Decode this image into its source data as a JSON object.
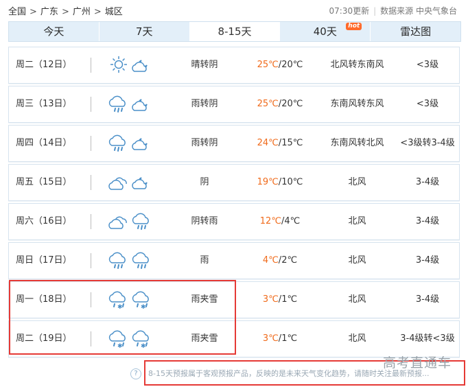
{
  "breadcrumb": {
    "items": [
      "全国",
      "广东",
      "广州",
      "城区"
    ],
    "sep": ">"
  },
  "update": {
    "time_text": "07:30更新",
    "source_text": "数据来源 中央气象台"
  },
  "tabs": [
    {
      "label": "今天"
    },
    {
      "label": "7天"
    },
    {
      "label": "8-15天"
    },
    {
      "label": "40天",
      "badge": "hot"
    },
    {
      "label": "雷达图"
    }
  ],
  "active_tab": "8-15天",
  "rows": [
    {
      "day": "周二（12日）",
      "icons": [
        "sun-icon",
        "cloudy-night-icon"
      ],
      "cond": "晴转阴",
      "hi": "25℃",
      "lo": "20℃",
      "wind": "北风转东南风",
      "level": "<3级"
    },
    {
      "day": "周三（13日）",
      "icons": [
        "rain-icon",
        "cloudy-night-icon"
      ],
      "cond": "雨转阴",
      "hi": "25℃",
      "lo": "20℃",
      "wind": "东南风转东风",
      "level": "<3级"
    },
    {
      "day": "周四（14日）",
      "icons": [
        "rain-icon",
        "cloudy-night-icon"
      ],
      "cond": "雨转阴",
      "hi": "24℃",
      "lo": "15℃",
      "wind": "东南风转北风",
      "level": "<3级转3-4级"
    },
    {
      "day": "周五（15日）",
      "icons": [
        "overcast-icon",
        "cloudy-night-icon"
      ],
      "cond": "阴",
      "hi": "19℃",
      "lo": "10℃",
      "wind": "北风",
      "level": "3-4级"
    },
    {
      "day": "周六（16日）",
      "icons": [
        "overcast-icon",
        "rain-icon"
      ],
      "cond": "阴转雨",
      "hi": "12℃",
      "lo": "4℃",
      "wind": "北风",
      "level": "3-4级"
    },
    {
      "day": "周日（17日）",
      "icons": [
        "rain-icon",
        "rain-icon"
      ],
      "cond": "雨",
      "hi": "4℃",
      "lo": "2℃",
      "wind": "北风",
      "level": "3-4级"
    },
    {
      "day": "周一（18日）",
      "icons": [
        "sleet-icon",
        "sleet-icon"
      ],
      "cond": "雨夹雪",
      "hi": "3℃",
      "lo": "1℃",
      "wind": "北风",
      "level": "3-4级"
    },
    {
      "day": "周二（19日）",
      "icons": [
        "sleet-icon",
        "sleet-icon"
      ],
      "cond": "雨夹雪",
      "hi": "3℃",
      "lo": "1℃",
      "wind": "北风",
      "level": "3-4级转<3级"
    }
  ],
  "temp_sep": "/",
  "note": {
    "qmark": "?",
    "text": "8-15天预报属于客观预报产品，反映的是未来天气变化趋势，请随时关注最新预报..."
  },
  "watermark": "高考直通车",
  "colors": {
    "hi_temp": "#f06a1a",
    "icon_blue": "#4a8fc8",
    "highlight_box": "#e53935"
  }
}
